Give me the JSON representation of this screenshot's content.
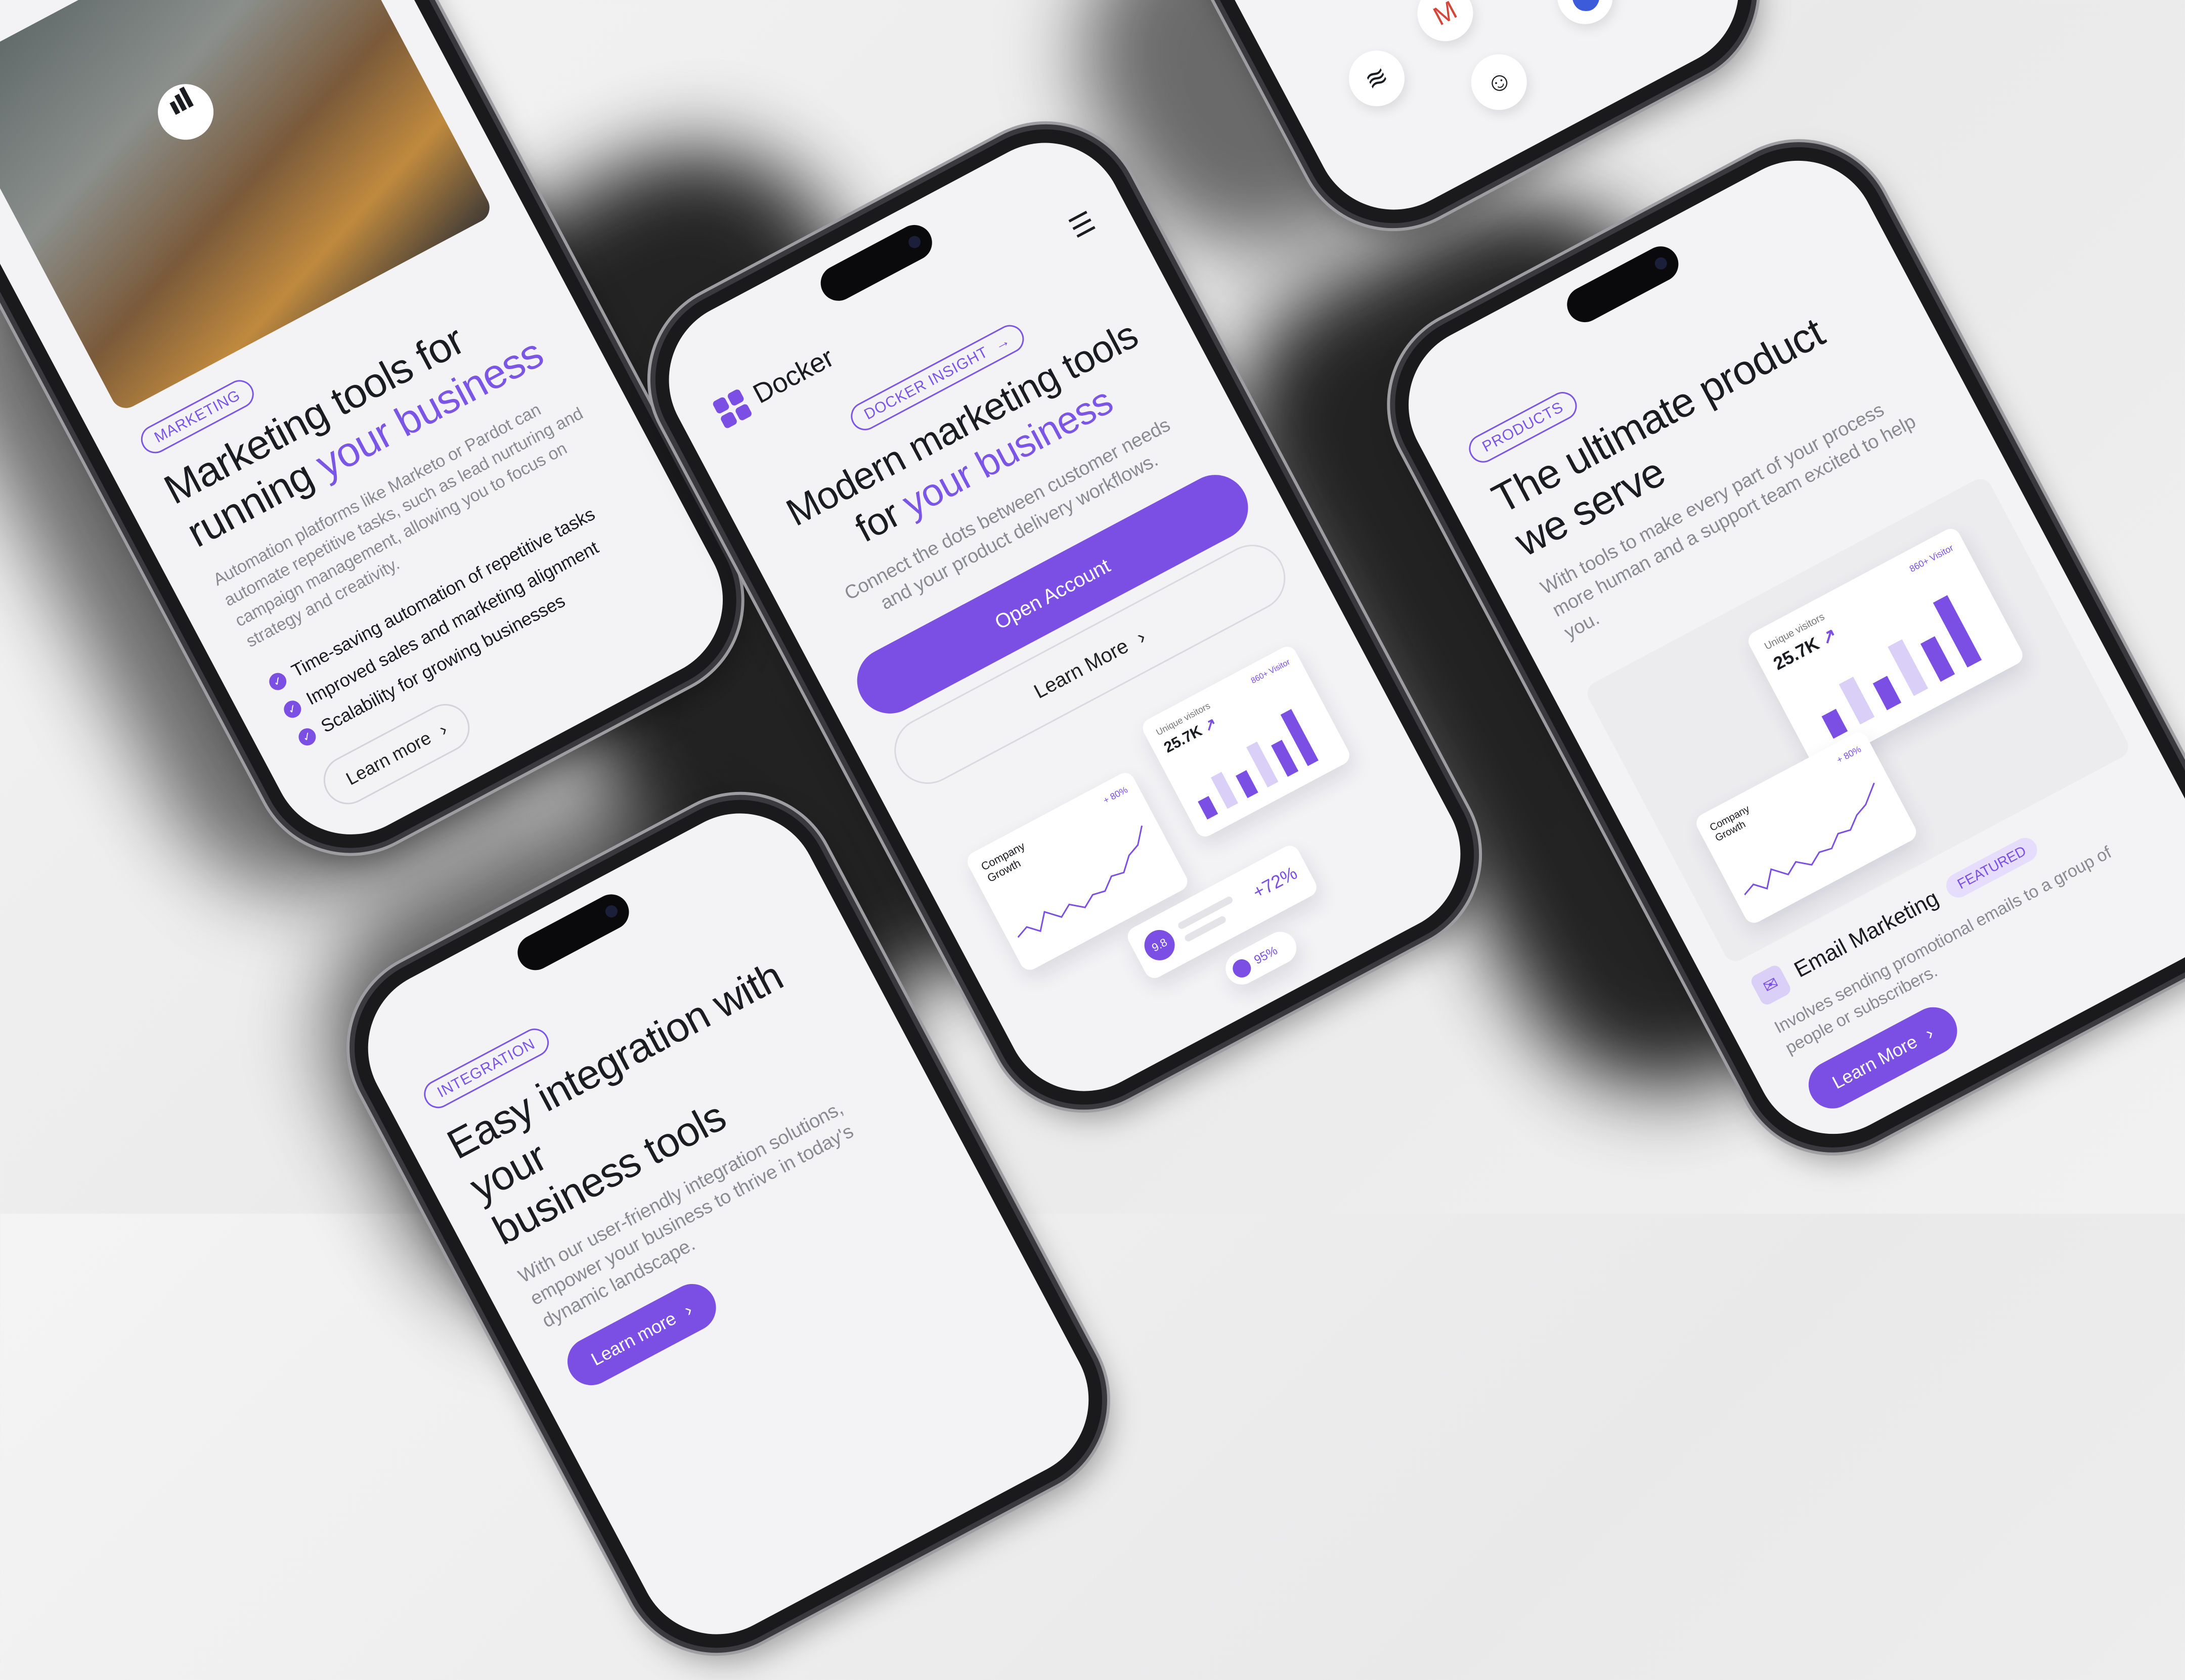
{
  "phone_marketing": {
    "tag": "MARKETING",
    "title_line1": "Marketing tools for",
    "title_line2_plain": "running ",
    "title_line2_accent": "your business",
    "body": "Automation platforms like Marketo or Pardot can automate repetitive tasks, such as lead nurturing and campaign management, allowing you to focus on strategy and creativity.",
    "bullets": [
      "Time-saving automation of repetitive tasks",
      "Improved sales and marketing alignment",
      "Scalability for growing businesses"
    ],
    "cta": "Learn more"
  },
  "phone_docker": {
    "brand": "Docker",
    "tag": "DOCKER INSIGHT",
    "title_line1": "Modern marketing tools",
    "title_line2_plain": "for ",
    "title_line2_accent": "your business",
    "body": "Connect the dots between customer needs and your product delivery workflows.",
    "primary_cta": "Open Account",
    "secondary_cta": "Learn More",
    "card_growth_title": "Company Growth",
    "card_growth_delta": "+ 80%",
    "card_visitors_label": "Unique visitors",
    "card_visitors_value": "25.7K",
    "card_visitors_badge": "860+ Visitor",
    "stat_change": "+72%",
    "stat_score": "9.8",
    "stat_percent": "95%"
  },
  "phone_products": {
    "tag": "PRODUCTS",
    "title_line1": "The ultimate product",
    "title_line2": "we serve",
    "body": "With tools to make every part of your process more human and a support team excited to help you.",
    "card_visitors_label": "Unique visitors",
    "card_visitors_value": "25.7K",
    "card_visitors_badge": "860+ Visitor",
    "card_growth_title": "Company Growth",
    "card_growth_delta": "+ 80%",
    "product_name": "Email Marketing",
    "product_badge": "FEATURED",
    "product_desc": "Involves sending promotional emails to a group of people or subscribers.",
    "cta": "Learn More"
  },
  "phone_integration": {
    "tag": "INTEGRATION",
    "title_line1": "Easy integration with your",
    "title_line2": "business tools",
    "body": "With our user-friendly integration solutions, empower your business to thrive in today's dynamic landscape.",
    "cta": "Learn more"
  },
  "phone_apps": {
    "icons": [
      "stack-icon",
      "gmail-icon",
      "slack-icon",
      "salesforce-icon",
      "mailchimp-icon",
      "pin-icon"
    ]
  },
  "colors": {
    "accent": "#7b4fe3",
    "background": "#f1f1f1",
    "phone_frame": "#1a1a1d"
  }
}
